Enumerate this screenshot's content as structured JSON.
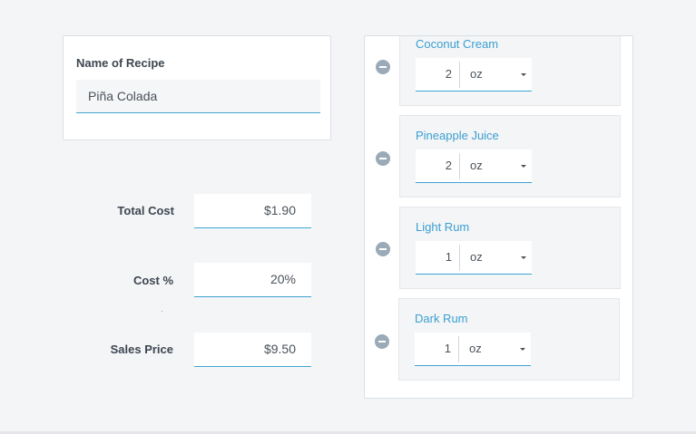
{
  "recipe": {
    "name_label": "Name of Recipe",
    "name_value": "Piña Colada"
  },
  "costs": {
    "total_cost_label": "Total Cost",
    "total_cost_value": "$1.90",
    "cost_pct_label": "Cost %",
    "cost_pct_value": "20%",
    "sales_price_label": "Sales Price",
    "sales_price_value": "$9.50"
  },
  "ingredients": [
    {
      "name": "Coconut Cream",
      "qty": "2",
      "unit": "oz"
    },
    {
      "name": "Pineapple Juice",
      "qty": "2",
      "unit": "oz"
    },
    {
      "name": "Light Rum",
      "qty": "1",
      "unit": "oz"
    },
    {
      "name": "Dark Rum",
      "qty": "1",
      "unit": "oz"
    }
  ],
  "icons": {
    "remove": "minus-circle-icon",
    "dropdown": "caret-down-icon"
  },
  "colors": {
    "accent": "#3ea4d3",
    "ingredient_text": "#3a9fd0",
    "remove_button": "#9aaab8"
  }
}
